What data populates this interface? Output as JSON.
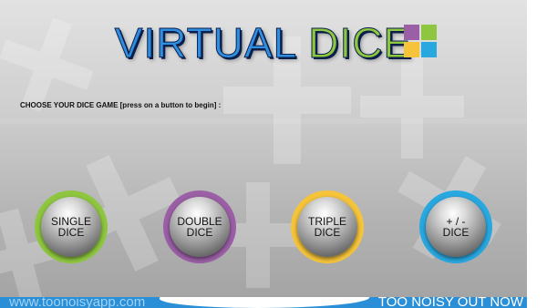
{
  "header": {
    "title_part1": "VIRTUAL",
    "title_part2": "DICE",
    "title_color_1": "#2f8ee0",
    "title_color_2": "#8ec63f",
    "logo_colors": [
      "#9b5fa6",
      "#8ec63f",
      "#f5c43a",
      "#29a8e0"
    ]
  },
  "instructions": "CHOOSE YOUR DICE GAME [press on a button to begin] :",
  "buttons": [
    {
      "line1": "SINGLE",
      "line2": "DICE",
      "ring_color": "#8ec63f"
    },
    {
      "line1": "DOUBLE",
      "line2": "DICE",
      "ring_color": "#9b5fa6"
    },
    {
      "line1": "TRIPLE",
      "line2": "DICE",
      "ring_color": "#f5c43a"
    },
    {
      "line1": "+ / -",
      "line2": "DICE",
      "ring_color": "#29a8e0"
    }
  ],
  "footer": {
    "left_link": "www.toonoisyapp.com",
    "right_text": "TOO NOISY OUT NOW"
  }
}
